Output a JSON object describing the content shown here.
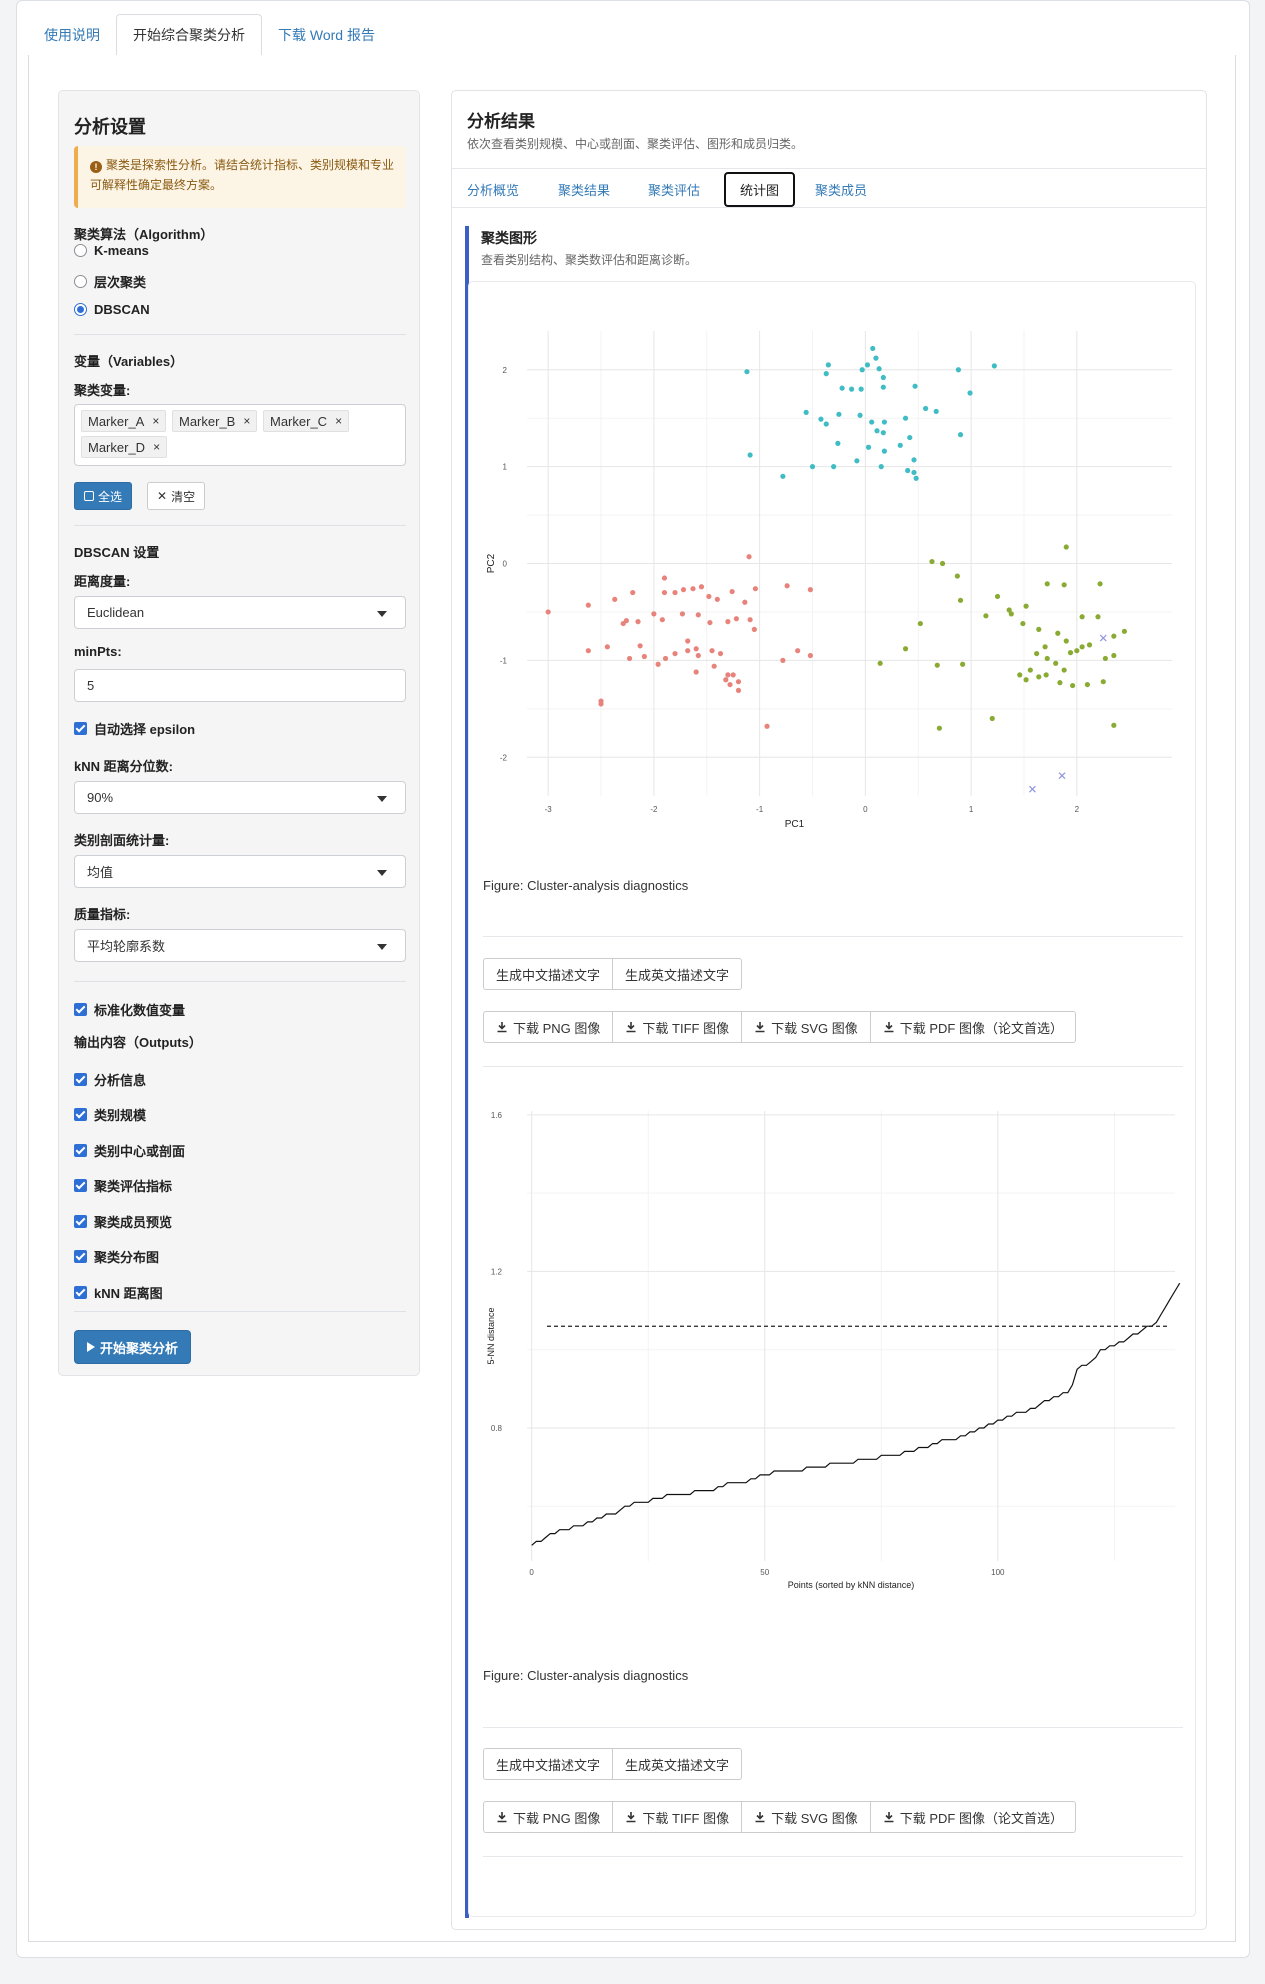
{
  "top_tabs": [
    {
      "label": "使用说明"
    },
    {
      "label": "开始综合聚类分析"
    },
    {
      "label": "下载 Word 报告"
    }
  ],
  "sidebar": {
    "title": "分析设置",
    "warning": "聚类是探索性分析。请结合统计指标、类别规模和专业可解释性确定最终方案。",
    "algorithm_label": "聚类算法（Algorithm）",
    "algorithms": [
      "K-means",
      "层次聚类",
      "DBSCAN"
    ],
    "algorithm_selected": "DBSCAN",
    "variables_label": "变量（Variables）",
    "cluster_vars_label": "聚类变量:",
    "vars": [
      "Marker_A",
      "Marker_B",
      "Marker_C",
      "Marker_D"
    ],
    "select_all": "全选",
    "clear": "清空",
    "dbscan_label": "DBSCAN 设置",
    "distance_label": "距离度量:",
    "distance_value": "Euclidean",
    "minpts_label": "minPts:",
    "minpts_value": "5",
    "auto_eps": "自动选择 epsilon",
    "knn_q_label": "kNN 距离分位数:",
    "knn_q_value": "90%",
    "profile_label": "类别剖面统计量:",
    "profile_value": "均值",
    "quality_label": "质量指标:",
    "quality_value": "平均轮廓系数",
    "standardize": "标准化数值变量",
    "outputs_label": "输出内容（Outputs）",
    "outputs": [
      "分析信息",
      "类别规模",
      "类别中心或剖面",
      "聚类评估指标",
      "聚类成员预览",
      "聚类分布图",
      "kNN 距离图"
    ],
    "run_button": "开始聚类分析"
  },
  "main": {
    "title": "分析结果",
    "subtitle": "依次查看类别规模、中心或剖面、聚类评估、图形和成员归类。",
    "tabs": [
      "分析概览",
      "聚类结果",
      "聚类评估",
      "统计图",
      "聚类成员"
    ],
    "active_tab": "统计图",
    "section_title": "聚类图形",
    "section_subtitle": "查看类别结构、聚类数评估和距离诊断。",
    "caption1": "Figure: Cluster-analysis diagnostics",
    "caption2": "Figure: Cluster-analysis diagnostics",
    "describe_buttons": [
      "生成中文描述文字",
      "生成英文描述文字"
    ],
    "download_buttons": [
      "下载 PNG 图像",
      "下载 TIFF 图像",
      "下载 SVG 图像",
      "下载 PDF 图像（论文首选）"
    ]
  },
  "colors": {
    "cluster1": "#e8837b",
    "cluster2": "#8aab33",
    "cluster3": "#40bcc4",
    "noise": "#8f95e0",
    "accent": "#337ab7"
  },
  "chart_data": [
    {
      "type": "scatter",
      "xlabel": "PC1",
      "ylabel": "PC2",
      "xlim": [
        -3.2,
        2.9
      ],
      "ylim": [
        -2.4,
        2.4
      ],
      "xticks": [
        -3,
        -2,
        -1,
        0,
        1,
        2
      ],
      "yticks": [
        -2,
        -1,
        0,
        1,
        2
      ],
      "grid": true,
      "series": [
        {
          "color_key": "cluster3",
          "points": [
            [
              0.07,
              2.22
            ],
            [
              0.1,
              2.12
            ],
            [
              0.02,
              2.05
            ],
            [
              -0.03,
              2.0
            ],
            [
              0.13,
              2.01
            ],
            [
              -0.35,
              2.05
            ],
            [
              0.17,
              1.92
            ],
            [
              -0.37,
              1.96
            ],
            [
              -0.22,
              1.81
            ],
            [
              -0.13,
              1.8
            ],
            [
              -0.04,
              1.8
            ],
            [
              0.17,
              1.82
            ],
            [
              0.47,
              1.83
            ],
            [
              0.88,
              2.0
            ],
            [
              1.22,
              2.04
            ],
            [
              -1.12,
              1.98
            ],
            [
              0.99,
              1.76
            ],
            [
              -0.56,
              1.56
            ],
            [
              -0.42,
              1.49
            ],
            [
              -0.37,
              1.44
            ],
            [
              -0.25,
              1.54
            ],
            [
              -0.05,
              1.53
            ],
            [
              0.06,
              1.46
            ],
            [
              0.18,
              1.46
            ],
            [
              0.38,
              1.5
            ],
            [
              0.57,
              1.6
            ],
            [
              0.67,
              1.57
            ],
            [
              0.11,
              1.37
            ],
            [
              0.17,
              1.35
            ],
            [
              0.42,
              1.3
            ],
            [
              0.9,
              1.33
            ],
            [
              -0.26,
              1.24
            ],
            [
              0.03,
              1.2
            ],
            [
              0.18,
              1.16
            ],
            [
              0.33,
              1.22
            ],
            [
              0.46,
              1.07
            ],
            [
              0.15,
              1.0
            ],
            [
              -0.08,
              1.06
            ],
            [
              -0.3,
              1.0
            ],
            [
              -0.5,
              1.0
            ],
            [
              0.46,
              0.94
            ],
            [
              0.48,
              0.88
            ],
            [
              0.4,
              0.96
            ],
            [
              -1.09,
              1.12
            ],
            [
              -0.78,
              0.9
            ]
          ]
        },
        {
          "color_key": "cluster1",
          "points": [
            [
              -2.2,
              -0.3
            ],
            [
              -2.37,
              -0.37
            ],
            [
              -2.62,
              -0.43
            ],
            [
              -3.0,
              -0.5
            ],
            [
              -2.29,
              -0.62
            ],
            [
              -2.26,
              -0.59
            ],
            [
              -2.15,
              -0.6
            ],
            [
              -2.0,
              -0.52
            ],
            [
              -1.9,
              -0.3
            ],
            [
              -1.9,
              -0.15
            ],
            [
              -1.8,
              -0.3
            ],
            [
              -1.72,
              -0.27
            ],
            [
              -1.63,
              -0.26
            ],
            [
              -1.55,
              -0.24
            ],
            [
              -1.48,
              -0.34
            ],
            [
              -1.4,
              -0.37
            ],
            [
              -1.26,
              -0.29
            ],
            [
              -1.1,
              0.07
            ],
            [
              -1.14,
              -0.4
            ],
            [
              -1.04,
              -0.26
            ],
            [
              -0.74,
              -0.23
            ],
            [
              -0.52,
              -0.27
            ],
            [
              -1.92,
              -0.58
            ],
            [
              -1.73,
              -0.52
            ],
            [
              -1.58,
              -0.53
            ],
            [
              -1.47,
              -0.61
            ],
            [
              -1.3,
              -0.6
            ],
            [
              -1.22,
              -0.57
            ],
            [
              -1.09,
              -0.58
            ],
            [
              -1.05,
              -0.68
            ],
            [
              -2.62,
              -0.9
            ],
            [
              -2.44,
              -0.86
            ],
            [
              -2.13,
              -0.85
            ],
            [
              -2.23,
              -0.98
            ],
            [
              -2.09,
              -0.96
            ],
            [
              -1.8,
              -0.93
            ],
            [
              -1.89,
              -0.98
            ],
            [
              -1.96,
              -1.04
            ],
            [
              -1.68,
              -0.8
            ],
            [
              -1.68,
              -0.9
            ],
            [
              -1.6,
              -0.88
            ],
            [
              -1.58,
              -0.95
            ],
            [
              -1.45,
              -0.9
            ],
            [
              -1.37,
              -0.93
            ],
            [
              -1.6,
              -1.12
            ],
            [
              -1.3,
              -1.15
            ],
            [
              -1.25,
              -1.15
            ],
            [
              -1.32,
              -1.2
            ],
            [
              -1.28,
              -1.25
            ],
            [
              -1.2,
              -1.31
            ],
            [
              -1.2,
              -1.22
            ],
            [
              -1.43,
              -1.06
            ],
            [
              -0.78,
              -1.0
            ],
            [
              -0.64,
              -0.9
            ],
            [
              -0.52,
              -0.95
            ],
            [
              -2.5,
              -1.42
            ],
            [
              -2.5,
              -1.45
            ],
            [
              -0.93,
              -1.68
            ]
          ]
        },
        {
          "color_key": "cluster2",
          "points": [
            [
              0.63,
              0.02
            ],
            [
              0.73,
              0.0
            ],
            [
              0.87,
              -0.13
            ],
            [
              0.9,
              -0.38
            ],
            [
              1.14,
              -0.54
            ],
            [
              1.25,
              -0.34
            ],
            [
              1.36,
              -0.48
            ],
            [
              1.52,
              -0.44
            ],
            [
              1.72,
              -0.21
            ],
            [
              1.88,
              -0.22
            ],
            [
              2.22,
              -0.21
            ],
            [
              1.9,
              0.17
            ],
            [
              0.52,
              -0.62
            ],
            [
              0.38,
              -0.88
            ],
            [
              0.14,
              -1.03
            ],
            [
              0.68,
              -1.05
            ],
            [
              0.92,
              -1.04
            ],
            [
              1.38,
              -0.52
            ],
            [
              1.49,
              -0.62
            ],
            [
              1.64,
              -0.68
            ],
            [
              1.7,
              -0.86
            ],
            [
              1.82,
              -0.72
            ],
            [
              1.9,
              -0.8
            ],
            [
              1.94,
              -0.92
            ],
            [
              2.0,
              -0.9
            ],
            [
              2.05,
              -0.86
            ],
            [
              2.12,
              -0.84
            ],
            [
              2.05,
              -0.55
            ],
            [
              2.2,
              -0.55
            ],
            [
              2.35,
              -0.75
            ],
            [
              2.45,
              -0.7
            ],
            [
              2.35,
              -0.95
            ],
            [
              2.27,
              -0.98
            ],
            [
              1.62,
              -0.93
            ],
            [
              1.72,
              -0.98
            ],
            [
              1.8,
              -1.03
            ],
            [
              1.88,
              -1.1
            ],
            [
              1.71,
              -1.15
            ],
            [
              1.64,
              -1.17
            ],
            [
              1.56,
              -1.1
            ],
            [
              1.52,
              -1.2
            ],
            [
              1.46,
              -1.15
            ],
            [
              1.84,
              -1.23
            ],
            [
              1.96,
              -1.26
            ],
            [
              2.1,
              -1.25
            ],
            [
              2.25,
              -1.22
            ],
            [
              1.2,
              -1.6
            ],
            [
              0.7,
              -1.7
            ],
            [
              2.35,
              -1.67
            ]
          ]
        },
        {
          "color_key": "noise",
          "marker": "x",
          "points": [
            [
              2.25,
              -0.77
            ],
            [
              1.58,
              -2.33
            ],
            [
              1.86,
              -2.19
            ]
          ]
        }
      ]
    },
    {
      "type": "line",
      "xlabel": "Points (sorted by kNN distance)",
      "ylabel": "5-NN distance",
      "xlim": [
        -1,
        138
      ],
      "ylim": [
        0.46,
        1.61
      ],
      "xticks": [
        0,
        50,
        100
      ],
      "yticks": [
        0.8,
        1.2,
        1.6
      ],
      "ytick_labels": [
        "0.8",
        "1.2",
        "1.6"
      ],
      "threshold": 1.06,
      "grid": true,
      "values": [
        0.5,
        0.51,
        0.51,
        0.52,
        0.53,
        0.53,
        0.54,
        0.54,
        0.54,
        0.55,
        0.55,
        0.55,
        0.56,
        0.56,
        0.57,
        0.57,
        0.58,
        0.58,
        0.58,
        0.59,
        0.6,
        0.6,
        0.61,
        0.61,
        0.61,
        0.61,
        0.62,
        0.62,
        0.62,
        0.63,
        0.63,
        0.63,
        0.63,
        0.63,
        0.63,
        0.64,
        0.64,
        0.64,
        0.64,
        0.64,
        0.65,
        0.65,
        0.66,
        0.66,
        0.66,
        0.66,
        0.66,
        0.67,
        0.67,
        0.68,
        0.68,
        0.68,
        0.69,
        0.69,
        0.69,
        0.69,
        0.69,
        0.69,
        0.69,
        0.7,
        0.7,
        0.7,
        0.7,
        0.7,
        0.71,
        0.71,
        0.71,
        0.71,
        0.71,
        0.71,
        0.72,
        0.72,
        0.72,
        0.72,
        0.72,
        0.73,
        0.73,
        0.73,
        0.73,
        0.73,
        0.74,
        0.74,
        0.74,
        0.75,
        0.75,
        0.75,
        0.76,
        0.76,
        0.77,
        0.77,
        0.77,
        0.77,
        0.78,
        0.78,
        0.79,
        0.79,
        0.8,
        0.8,
        0.81,
        0.81,
        0.82,
        0.82,
        0.83,
        0.83,
        0.84,
        0.84,
        0.84,
        0.85,
        0.85,
        0.86,
        0.87,
        0.87,
        0.88,
        0.88,
        0.89,
        0.89,
        0.91,
        0.95,
        0.96,
        0.96,
        0.97,
        0.98,
        1.0,
        1.0,
        1.01,
        1.01,
        1.02,
        1.02,
        1.03,
        1.04,
        1.04,
        1.05,
        1.06,
        1.06,
        1.07,
        1.09,
        1.11,
        1.13,
        1.15,
        1.17
      ]
    }
  ]
}
